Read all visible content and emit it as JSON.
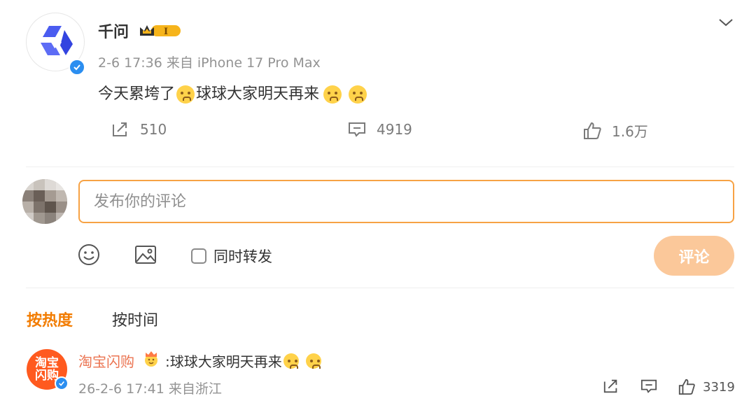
{
  "post": {
    "author": "千问",
    "level_badge": "I",
    "meta": "2-6 17:36  来自 iPhone 17 Pro Max",
    "content_part1": "今天累垮了",
    "content_part2": "球球大家明天再来",
    "actions": {
      "repost_count": "510",
      "comment_count": "4919",
      "like_count": "1.6万"
    }
  },
  "composer": {
    "placeholder": "发布你的评论",
    "repost_option": "同时转发",
    "submit_label": "评论"
  },
  "sort": {
    "hot": "按热度",
    "time": "按时间"
  },
  "comment": {
    "avatar_text": "淘宝\n闪购",
    "author": "淘宝闪购",
    "text": ":球球大家明天再来",
    "meta": "26-2-6 17:41  来自浙江",
    "like_count": "3319"
  },
  "colors": {
    "accent": "#f27c00",
    "input_border": "#f7a244",
    "submit_bg": "#fbc89a",
    "verified": "#2b8ef0",
    "comment_name": "#eb7350"
  },
  "icons": [
    "qwen-logo-icon",
    "verified-icon",
    "crown-badge-icon",
    "chevron-down-icon",
    "repost-icon",
    "comment-icon",
    "like-icon",
    "emoji-icon",
    "image-icon"
  ]
}
